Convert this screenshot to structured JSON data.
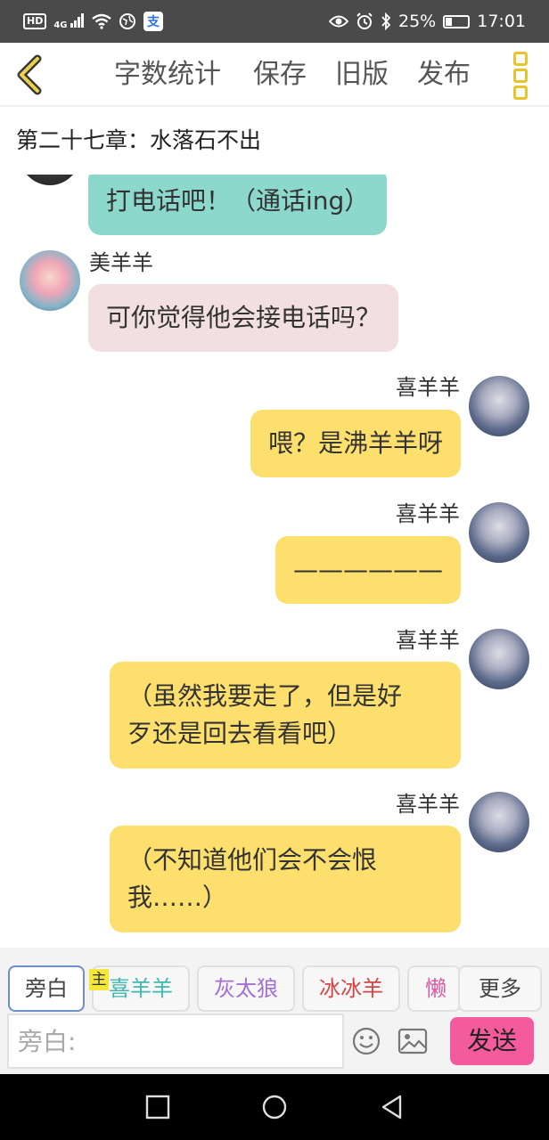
{
  "status_bar": {
    "left_badge": "HD",
    "signal_label": "4G",
    "app_icon": "支",
    "battery": "25%",
    "time": "17:01",
    "icons": [
      "hd-icon",
      "signal-icon",
      "wifi-icon",
      "vpn-icon",
      "alipay-icon",
      "eye-icon",
      "alarm-icon",
      "bluetooth-icon",
      "battery-icon"
    ]
  },
  "toolbar": {
    "word_count": "字数统计",
    "save": "保存",
    "old_version": "旧版",
    "publish": "发布",
    "accent_color": "#e8c42c"
  },
  "chapter": {
    "title": "第二十七章：水落石不出"
  },
  "messages": [
    {
      "side": "left",
      "speaker": "",
      "text": "打电话吧！（通话ing）",
      "color": "#8cd8cc"
    },
    {
      "side": "left",
      "speaker": "美羊羊",
      "text": "可你觉得他会接电话吗？",
      "color": "#f1dfe2"
    },
    {
      "side": "right",
      "speaker": "喜羊羊",
      "text": "喂？是沸羊羊呀",
      "color": "#fddf6d"
    },
    {
      "side": "right",
      "speaker": "喜羊羊",
      "text": "——————",
      "color": "#fddf6d"
    },
    {
      "side": "right",
      "speaker": "喜羊羊",
      "text_lines": [
        "（虽然我要走了，但是好",
        "歹还是回去看看吧）"
      ],
      "color": "#fddf6d"
    },
    {
      "side": "right",
      "speaker": "喜羊羊",
      "text_lines": [
        "（不知道他们会不会恨",
        "我……）"
      ],
      "color": "#fddf6d"
    }
  ],
  "roles": {
    "narration": "旁白",
    "main_tag": "主",
    "xiyangyang": "喜羊羊",
    "huitailang": "灰太狼",
    "bingbingyang": "冰冰羊",
    "lanyangyang": "懒羊羊",
    "more": "更多"
  },
  "input": {
    "placeholder": "旁白:",
    "value": ""
  },
  "send_button": "发送",
  "send_color": "#f45b9c"
}
